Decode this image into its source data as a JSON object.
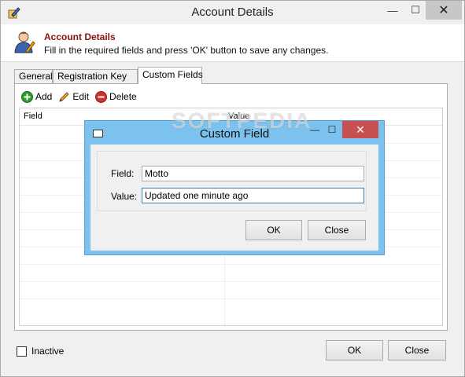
{
  "window": {
    "title": "Account Details",
    "minimize": "—",
    "maximize": "☐",
    "close": "✕"
  },
  "header": {
    "title": "Account Details",
    "description": "Fill in the required fields and press 'OK' button to save any changes."
  },
  "tabs": [
    {
      "label": "General"
    },
    {
      "label": "Registration Key"
    },
    {
      "label": "Custom Fields"
    }
  ],
  "toolbar": {
    "add_label": "Add",
    "edit_label": "Edit",
    "delete_label": "Delete"
  },
  "grid": {
    "columns": [
      "Field",
      "Value"
    ]
  },
  "footer": {
    "inactive_label": "Inactive",
    "ok_label": "OK",
    "close_label": "Close"
  },
  "dialog": {
    "title": "Custom Field",
    "minimize": "—",
    "maximize": "☐",
    "close": "✕",
    "field_label": "Field:",
    "field_value": "Motto",
    "value_label": "Value:",
    "value_value": "Updated one minute ago",
    "ok_label": "OK",
    "close_label": "Close"
  },
  "watermark": "SOFTPEDIA",
  "colors": {
    "header_title": "#8b1010",
    "dialog_frame": "#7cc2ee",
    "dialog_close": "#c75050",
    "add_green": "#2a9d2a",
    "delete_red": "#d03030"
  }
}
